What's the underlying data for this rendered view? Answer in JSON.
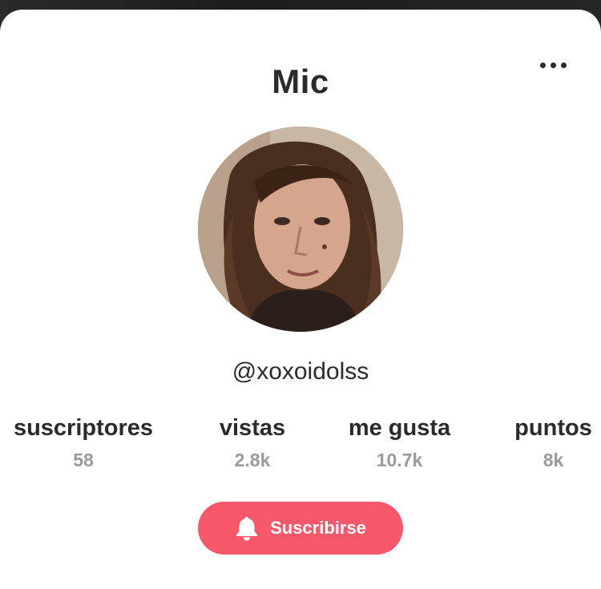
{
  "profile": {
    "name": "Mic",
    "handle": "@xoxoidolss"
  },
  "stats": [
    {
      "label": "suscriptores",
      "value": "58"
    },
    {
      "label": "vistas",
      "value": "2.8k"
    },
    {
      "label": "me gusta",
      "value": "10.7k"
    },
    {
      "label": "puntos",
      "value": "8k"
    }
  ],
  "actions": {
    "subscribe_label": "Suscribirse",
    "subscribe_icon": "bell-icon",
    "more_icon": "more-options-icon"
  },
  "colors": {
    "accent": "#f5596a",
    "text": "#2b2b2b",
    "muted": "#9a9a9a"
  }
}
